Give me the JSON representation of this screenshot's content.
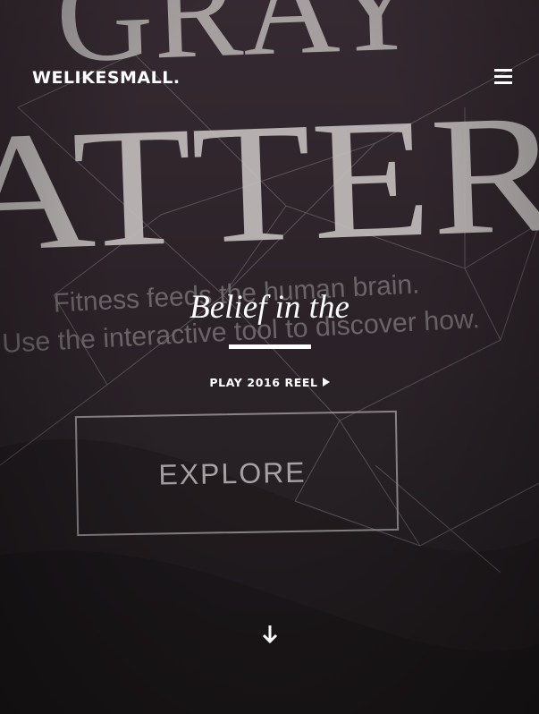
{
  "header": {
    "brand": "WELIKESMALL.",
    "menu_icon": "hamburger-menu-icon"
  },
  "background": {
    "headline_line1": "GRAY",
    "headline_line2": "ATTER",
    "copy_line1": "Fitness feeds the human brain.",
    "copy_line2": "Use the interactive tool to discover how.",
    "button_label": "EXPLORE"
  },
  "hero": {
    "tagline": "Belief in the",
    "reel_label": "PLAY 2016 REEL",
    "reel_icon": "play-triangle-icon",
    "scroll_icon": "arrow-down-icon"
  },
  "colors": {
    "overlay_text": "#ffffff",
    "background_dark": "#2c2329"
  }
}
